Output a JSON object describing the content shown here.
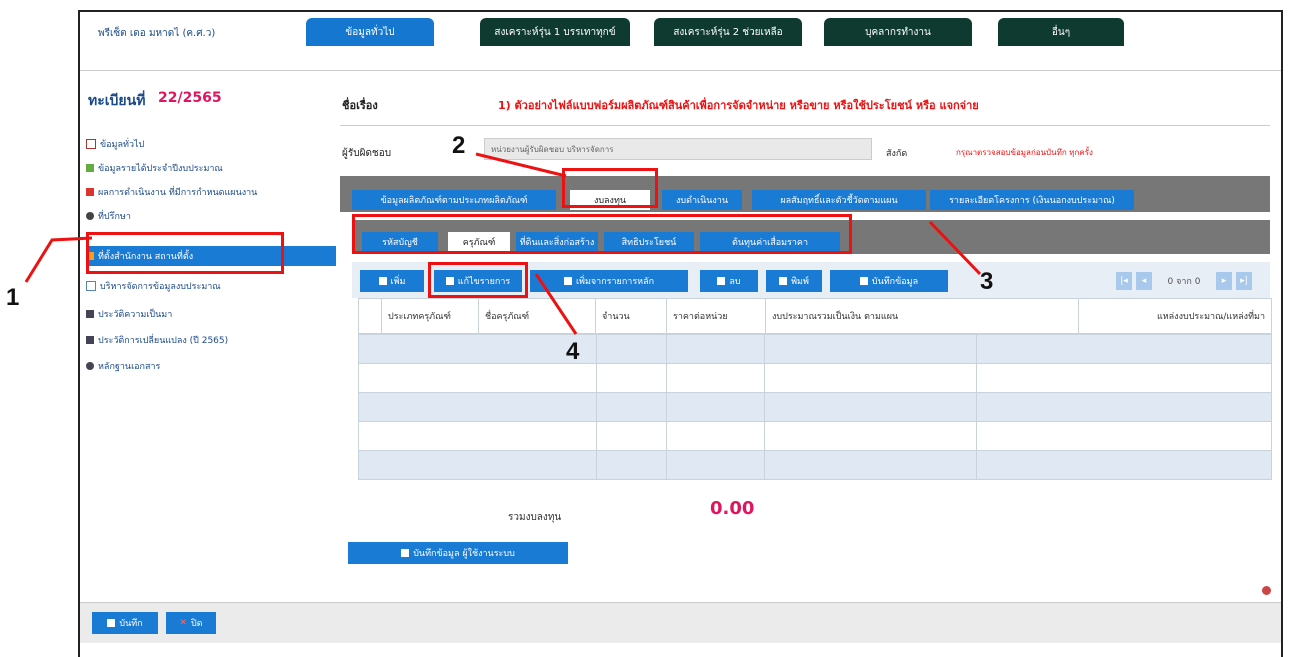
{
  "header": {
    "org_label": "พรีเซ็ต เดอ มหาดไ (ค.ศ.ว)",
    "tabs": [
      "ข้อมูลทั่วไป",
      "สงเคราะห์รุ่น 1 บรรเทาทุกข์",
      "สงเคราะห์รุ่น 2 ช่วยเหลือ",
      "บุคลากรทำงาน",
      "อื่นๆ"
    ]
  },
  "sidebar": {
    "year_label": "ทะเบียนที่",
    "year_value": "22/2565",
    "items": [
      "ข้อมูลทั่วไป",
      "ข้อมูลรายได้ประจำปีงบประมาณ",
      "ผลการดำเนินงาน ที่มีการกำหนดแผนงาน",
      "ที่ปรึกษา",
      "ที่ตั้งสำนักงาน สถานที่ตั้ง",
      "บริหารจัดการข้อมูลงบประมาณ",
      "ประวัติความเป็นมา",
      "ประวัติการเปลี่ยนแปลง (ปี 2565)",
      "หลักฐานเอกสาร"
    ],
    "selected_index": 4
  },
  "main": {
    "title_label": "ชื่อเรื่อง",
    "notice": "1) ตัวอย่างไฟล์แบบฟอร์มผลิตภัณฑ์สินค้าเพื่อการจัดจำหน่าย หรือขาย หรือใช้ประโยชน์ หรือ แจกจ่าย",
    "field_label": "ผู้รับผิดชอบ",
    "field_value": "หน่วยงานผู้รับผิดชอบ บริหารจัดการ",
    "side_label": "สังกัด",
    "side_note": "กรุณาตรวจสอบข้อมูลก่อนบันทึก ทุกครั้ง",
    "main_tabs": [
      "ข้อมูลผลิตภัณฑ์ตามประเภทผลิตภัณฑ์",
      "งบลงทุน",
      "งบดำเนินงาน",
      "ผลสัมฤทธิ์และตัวชี้วัดตามแผน",
      "รายละเอียดโครงการ (เงินนอกงบประมาณ)"
    ],
    "sub_tabs": [
      "รหัสบัญชี",
      "ครุภัณฑ์",
      "ที่ดินและสิ่งก่อสร้าง",
      "สิทธิประโยชน์",
      "ต้นทุนค่าเสื่อมราคา"
    ],
    "toolbar": [
      "เพิ่ม",
      "แก้ไขรายการ",
      "เพิ่มจากรายการหลัก",
      "ลบ",
      "พิมพ์",
      "บันทึกข้อมูล"
    ],
    "pager_text": "0 จาก 0",
    "columns": [
      "ประเภทครุภัณฑ์",
      "ชื่อครุภัณฑ์",
      "จำนวน",
      "ราคาต่อหน่วย",
      "งบประมาณรวมเป็นเงิน ตามแผน",
      "แหล่งงบประมาณ/แหล่งที่มา"
    ],
    "total_label": "รวมงบลงทุน",
    "total_value": "0.00",
    "save_button": "บันทึกข้อมูล ผู้ใช้งานระบบ"
  },
  "footer": {
    "save": "บันทึก",
    "close": "ปิด"
  },
  "callouts": [
    "1",
    "2",
    "3",
    "4"
  ],
  "colors": {
    "accent_blue": "#1a7bd4",
    "dark_tab": "#0f3a30",
    "highlight_red": "#e11111",
    "total_red": "#e0155e"
  }
}
